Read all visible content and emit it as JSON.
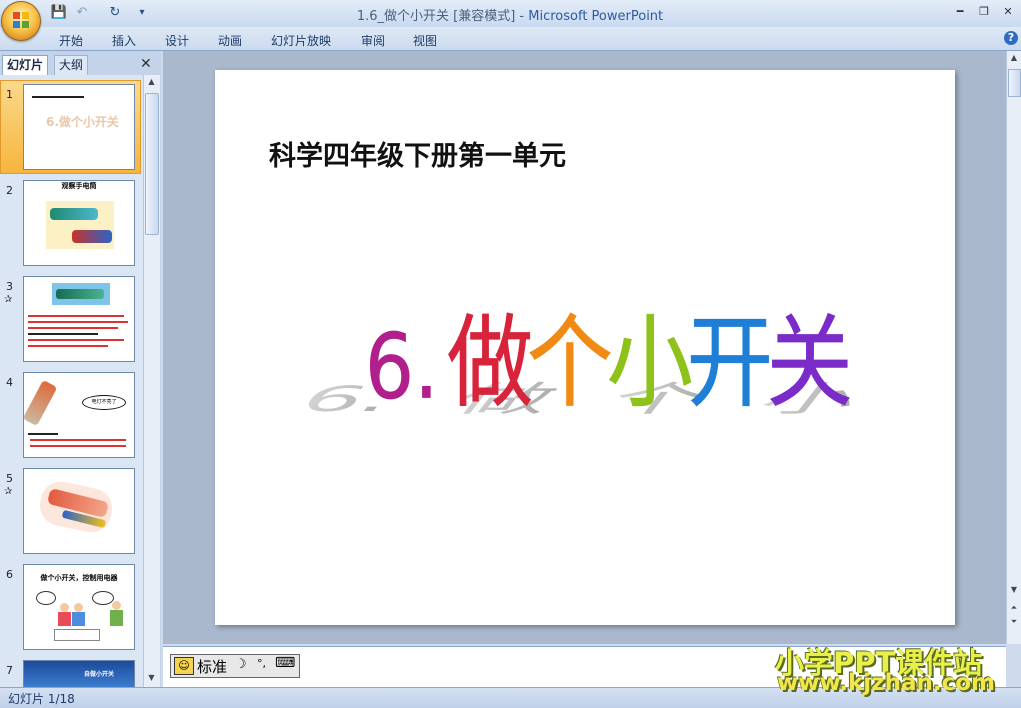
{
  "window": {
    "title": "1.6_做个小开关 [兼容模式]",
    "app_name": "Microsoft PowerPoint",
    "separator": " - "
  },
  "quick_access": {
    "save": "💾",
    "undo": "↶",
    "redo": "↻",
    "more": "▾"
  },
  "ribbon": {
    "tabs": [
      "开始",
      "插入",
      "设计",
      "动画",
      "幻灯片放映",
      "审阅",
      "视图"
    ],
    "help": "?"
  },
  "left_panel": {
    "tab_slides": "幻灯片",
    "tab_outline": "大纲",
    "close": "✕",
    "thumbnails": [
      {
        "num": "1"
      },
      {
        "num": "2"
      },
      {
        "num": "3"
      },
      {
        "num": "4"
      },
      {
        "num": "5"
      },
      {
        "num": "6"
      },
      {
        "num": "7"
      }
    ],
    "thumb_titles": {
      "t1_main": "6.做个小开关",
      "t2_title": "观察手电筒",
      "t4_bubble": "电灯不亮了",
      "t6_title": "做个小开关，控制用电器",
      "t7_title": "自做小开关"
    }
  },
  "slide": {
    "subtitle": "科学四年级下册第一单元",
    "title": "6.做个小开关",
    "title_chars": [
      "6.",
      "做",
      "个",
      "小",
      "开",
      "关"
    ],
    "title_colors": [
      "#b01f8c",
      "#d8243a",
      "#f08a14",
      "#8ec21a",
      "#1f7fd6",
      "#7a2bc8"
    ]
  },
  "ime": {
    "label": "标准",
    "icon_moon": "☽",
    "icon_punct": "°,",
    "icon_kb": "⌨"
  },
  "status_bar": {
    "text": "幻灯片 1/18"
  },
  "watermark": {
    "line1": "小学PPT课件站",
    "line2": "www.kjzhan.com"
  }
}
